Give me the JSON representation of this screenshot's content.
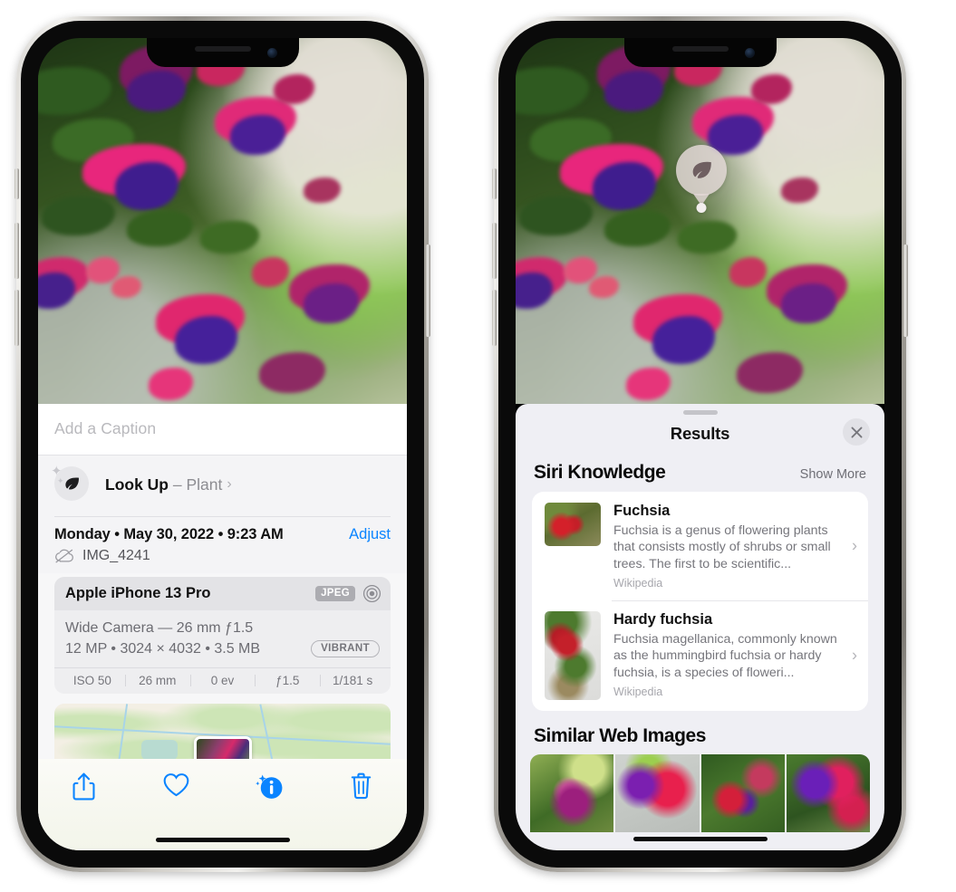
{
  "left_phone": {
    "caption": {
      "placeholder": "Add a Caption",
      "value": ""
    },
    "look_up": {
      "label": "Look Up",
      "dash": "–",
      "subject": "Plant",
      "chevron": "›",
      "icon": "leaf-icon"
    },
    "info": {
      "date": "Monday • May 30, 2022 • 9:23 AM",
      "adjust_label": "Adjust",
      "filename": "IMG_4241",
      "filename_icon": "cloud-slash-icon"
    },
    "camera_card": {
      "device": "Apple iPhone 13 Pro",
      "format_badge": "JPEG",
      "aperture_icon": "lens-icon",
      "lens_line": "Wide Camera — 26 mm ƒ1.5",
      "specs_line": "12 MP • 3024 × 4032 • 3.5 MB",
      "style_badge": "VIBRANT",
      "exif": [
        "ISO 50",
        "26 mm",
        "0 ev",
        "ƒ1.5",
        "1/181 s"
      ]
    },
    "toolbar": [
      {
        "name": "share-button",
        "icon": "share-icon"
      },
      {
        "name": "favorite-button",
        "icon": "heart-icon"
      },
      {
        "name": "info-button",
        "icon": "info-sparkle-icon"
      },
      {
        "name": "delete-button",
        "icon": "trash-icon"
      }
    ],
    "accent_color": "#0a84ff"
  },
  "right_phone": {
    "leaf_badge": {
      "icon": "leaf-icon"
    },
    "results": {
      "title": "Results",
      "close_icon": "close-icon",
      "siri_knowledge": {
        "title": "Siri Knowledge",
        "show_more": "Show More",
        "items": [
          {
            "title": "Fuchsia",
            "description": "Fuchsia is a genus of flowering plants that consists mostly of shrubs or small trees. The first to be scientific...",
            "source": "Wikipedia",
            "chevron": "›"
          },
          {
            "title": "Hardy fuchsia",
            "description": "Fuchsia magellanica, commonly known as the hummingbird fuchsia or hardy fuchsia, is a species of floweri...",
            "source": "Wikipedia",
            "chevron": "›"
          }
        ]
      },
      "similar_web_images": {
        "title": "Similar Web Images",
        "count": 4
      }
    }
  }
}
